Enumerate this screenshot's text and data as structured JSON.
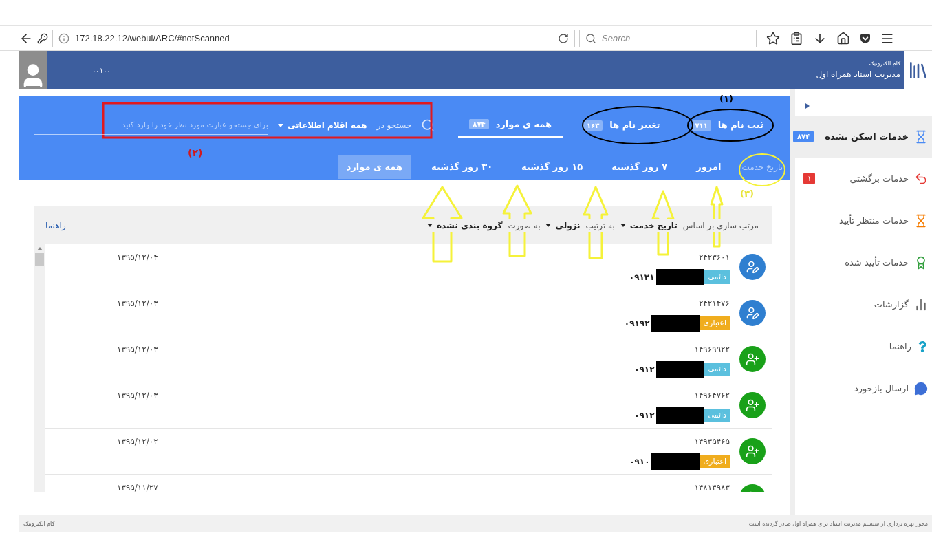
{
  "browser": {
    "url": "172.18.22.12/webui/ARC/#notScanned",
    "search_placeholder": "Search"
  },
  "header": {
    "company": "کام الکترونیک",
    "app_title": "مدیریت اسناد همراه اول",
    "user_text": "۰۰۱۰۰"
  },
  "tabs": [
    {
      "label": "ثبت نام ها",
      "count": "۷۱۱",
      "selected": false
    },
    {
      "label": "تغییر نام ها",
      "count": "۱۶۳",
      "selected": false
    },
    {
      "label": "همه ی موارد",
      "count": "۸۷۴",
      "selected": true
    }
  ],
  "search": {
    "label": "جستجو در",
    "scope": "همه اقلام اطلاعاتی",
    "placeholder": "برای جستجو عبارت مورد نظر خود را وارد کنید"
  },
  "date_filter": {
    "label": "تاریخ خدمت",
    "options": [
      {
        "label": "امروز",
        "selected": false
      },
      {
        "label": "۷ روز گذشته",
        "selected": false
      },
      {
        "label": "۱۵ روز گذشته",
        "selected": false
      },
      {
        "label": "۳۰ روز گذشته",
        "selected": false
      },
      {
        "label": "همه ی موارد",
        "selected": true
      }
    ]
  },
  "sort_bar": {
    "items": [
      {
        "kind": "text",
        "label": "مرتب سازی بر اساس"
      },
      {
        "kind": "dropdown",
        "label": "تاریخ خدمت"
      },
      {
        "kind": "text",
        "label": "به ترتیب"
      },
      {
        "kind": "dropdown",
        "label": "نزولی"
      },
      {
        "kind": "text",
        "label": "به صورت"
      },
      {
        "kind": "dropdown",
        "label": "گروه بندی نشده"
      }
    ],
    "help_link": "راهنما"
  },
  "rows": [
    {
      "kind": "edit",
      "id": "۲۴۲۳۶۰۱",
      "tag": {
        "kind": "permanent",
        "label": "دائمی"
      },
      "phone": "۰۹۱۲۱",
      "date": "۱۳۹۵/۱۲/۰۴"
    },
    {
      "kind": "edit",
      "id": "۲۴۲۱۴۷۶",
      "tag": {
        "kind": "credit",
        "label": "اعتباری"
      },
      "phone": "۰۹۱۹۲",
      "date": "۱۳۹۵/۱۲/۰۳"
    },
    {
      "kind": "add",
      "id": "۱۴۹۶۹۹۲۲",
      "tag": {
        "kind": "permanent",
        "label": "دائمی"
      },
      "phone": "۰۹۱۲",
      "date": "۱۳۹۵/۱۲/۰۳"
    },
    {
      "kind": "add",
      "id": "۱۴۹۶۴۷۶۲",
      "tag": {
        "kind": "permanent",
        "label": "دائمی"
      },
      "phone": "۰۹۱۲",
      "date": "۱۳۹۵/۱۲/۰۳"
    },
    {
      "kind": "add",
      "id": "۱۴۹۳۵۴۶۵",
      "tag": {
        "kind": "credit",
        "label": "اعتباری"
      },
      "phone": "۰۹۱۰",
      "date": "۱۳۹۵/۱۲/۰۲"
    },
    {
      "kind": "add",
      "id": "۱۴۸۱۴۹۸۳",
      "date": "۱۳۹۵/۱۱/۲۷"
    }
  ],
  "sidebar": {
    "items": [
      {
        "label": "خدمات اسکن نشده",
        "badge": "۸۷۴",
        "color": "#4a8af4",
        "selected": true
      },
      {
        "label": "خدمات برگشتی",
        "badge": "۱",
        "color": "#e53935",
        "selected": false
      },
      {
        "label": "خدمات منتظر تأیید",
        "selected": false
      },
      {
        "label": "خدمات تأیید شده",
        "selected": false
      },
      {
        "label": "گزارشات",
        "selected": false
      },
      {
        "label": "راهنما",
        "selected": false
      },
      {
        "label": "ارسال بازخورد",
        "selected": false
      }
    ]
  },
  "footer": {
    "left": "کام الکترونیک",
    "right": "مجوز بهره برداری از سیستم مدیریت اسناد برای همراه اول صادر گردیده است."
  },
  "annotations": {
    "labels": [
      "(۱)",
      "(۲)",
      "(۳)"
    ]
  }
}
